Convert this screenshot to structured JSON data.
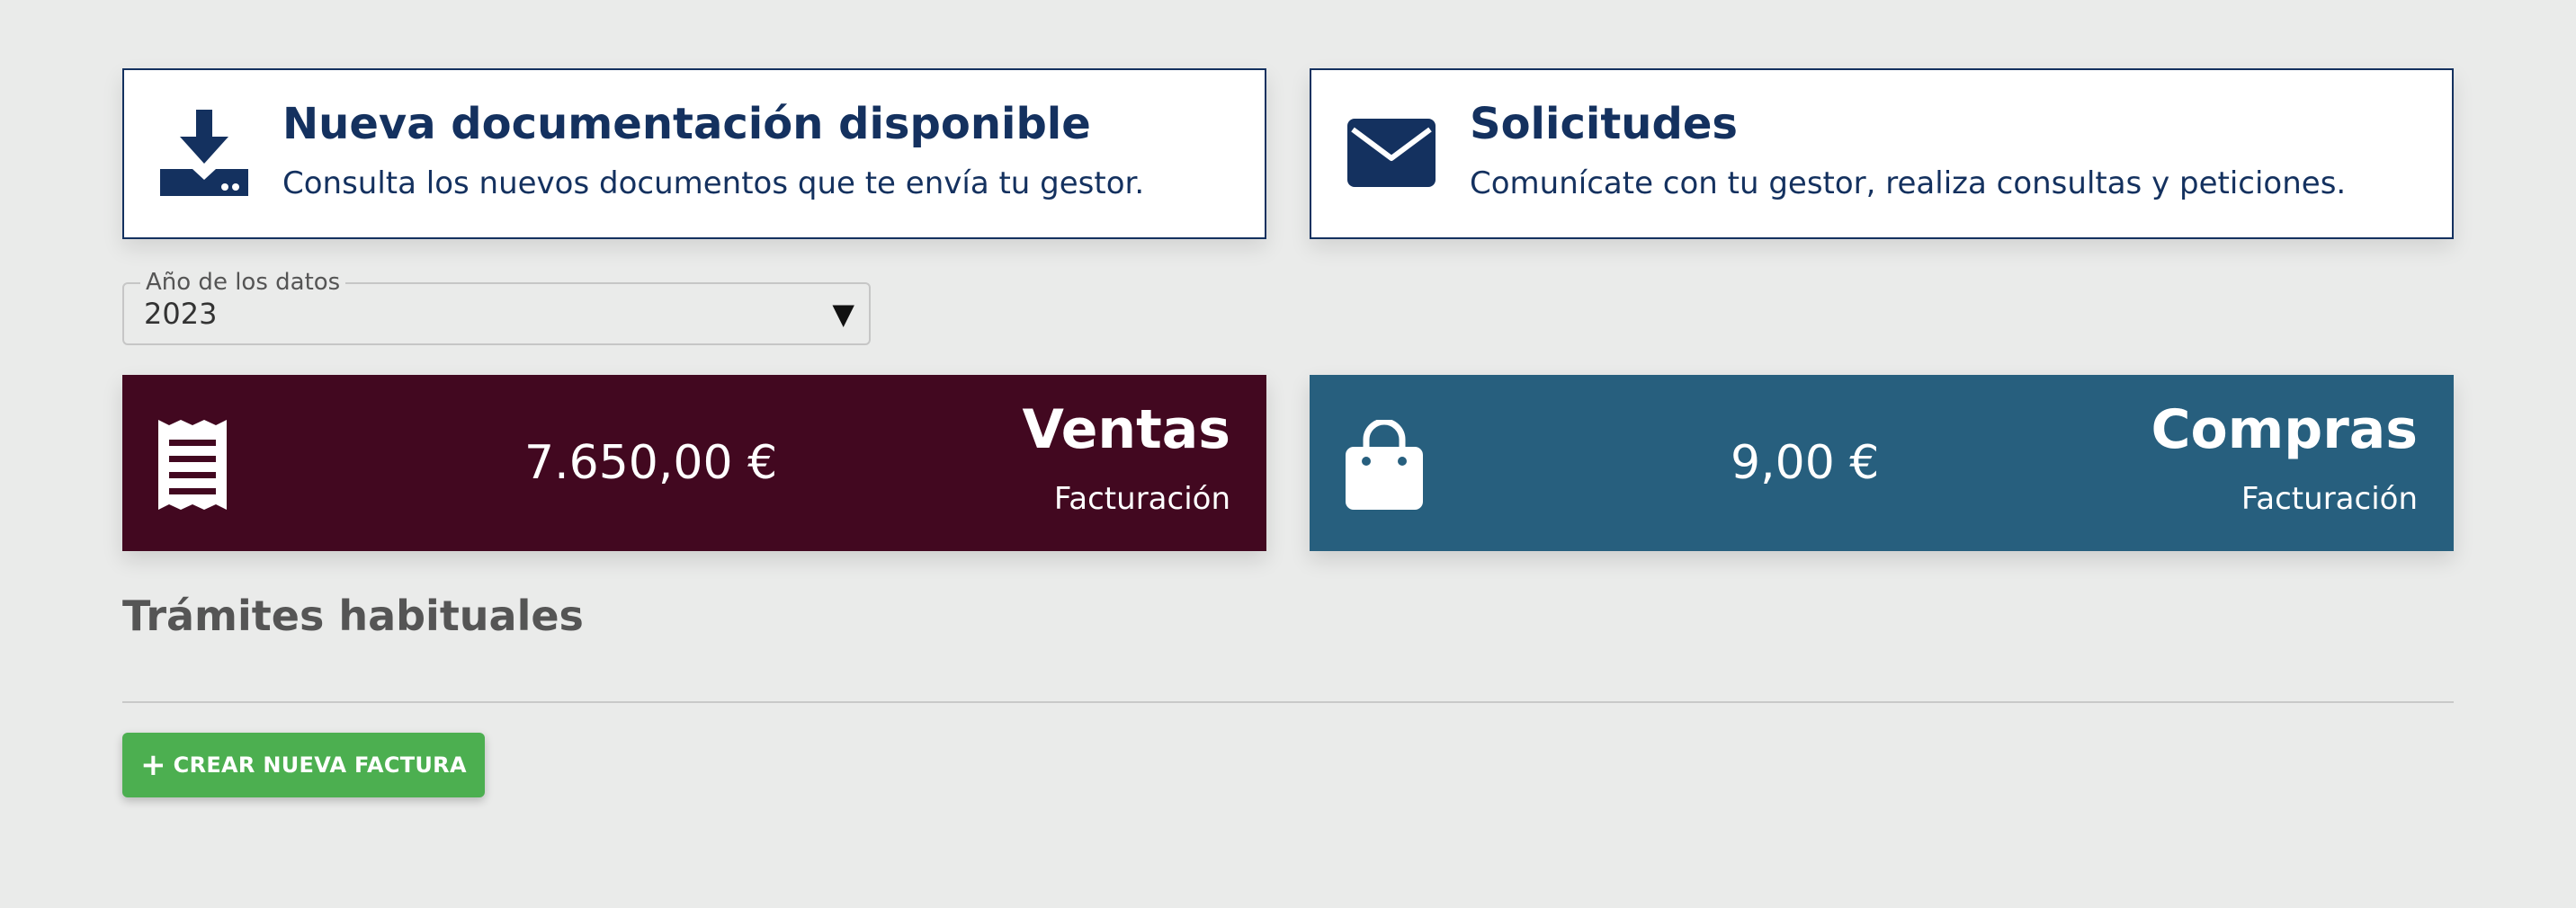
{
  "cards": {
    "documentation": {
      "title": "Nueva documentación disponible",
      "description": "Consulta los nuevos documentos que te envía tu gestor.",
      "icon": "download-tray-icon"
    },
    "requests": {
      "title": "Solicitudes",
      "description": "Comunícate con tu gestor, realiza consultas y peticiones.",
      "icon": "envelope-icon"
    }
  },
  "year_select": {
    "label": "Año de los datos",
    "value": "2023",
    "icon": "caret-down-icon"
  },
  "stats": {
    "sales": {
      "amount": "7.650,00 €",
      "name": "Ventas",
      "subtitle": "Facturación",
      "icon": "receipt-icon",
      "color": "#420820"
    },
    "purchases": {
      "amount": "9,00 €",
      "name": "Compras",
      "subtitle": "Facturación",
      "icon": "shopping-bag-icon",
      "color": "#275f7e"
    }
  },
  "procedures": {
    "title": "Trámites habituales",
    "create_invoice_label": "CREAR NUEVA FACTURA",
    "create_invoice_icon": "plus-icon"
  },
  "colors": {
    "navy": "#14315f",
    "background": "#eaebea",
    "button_green": "#4caf50"
  }
}
